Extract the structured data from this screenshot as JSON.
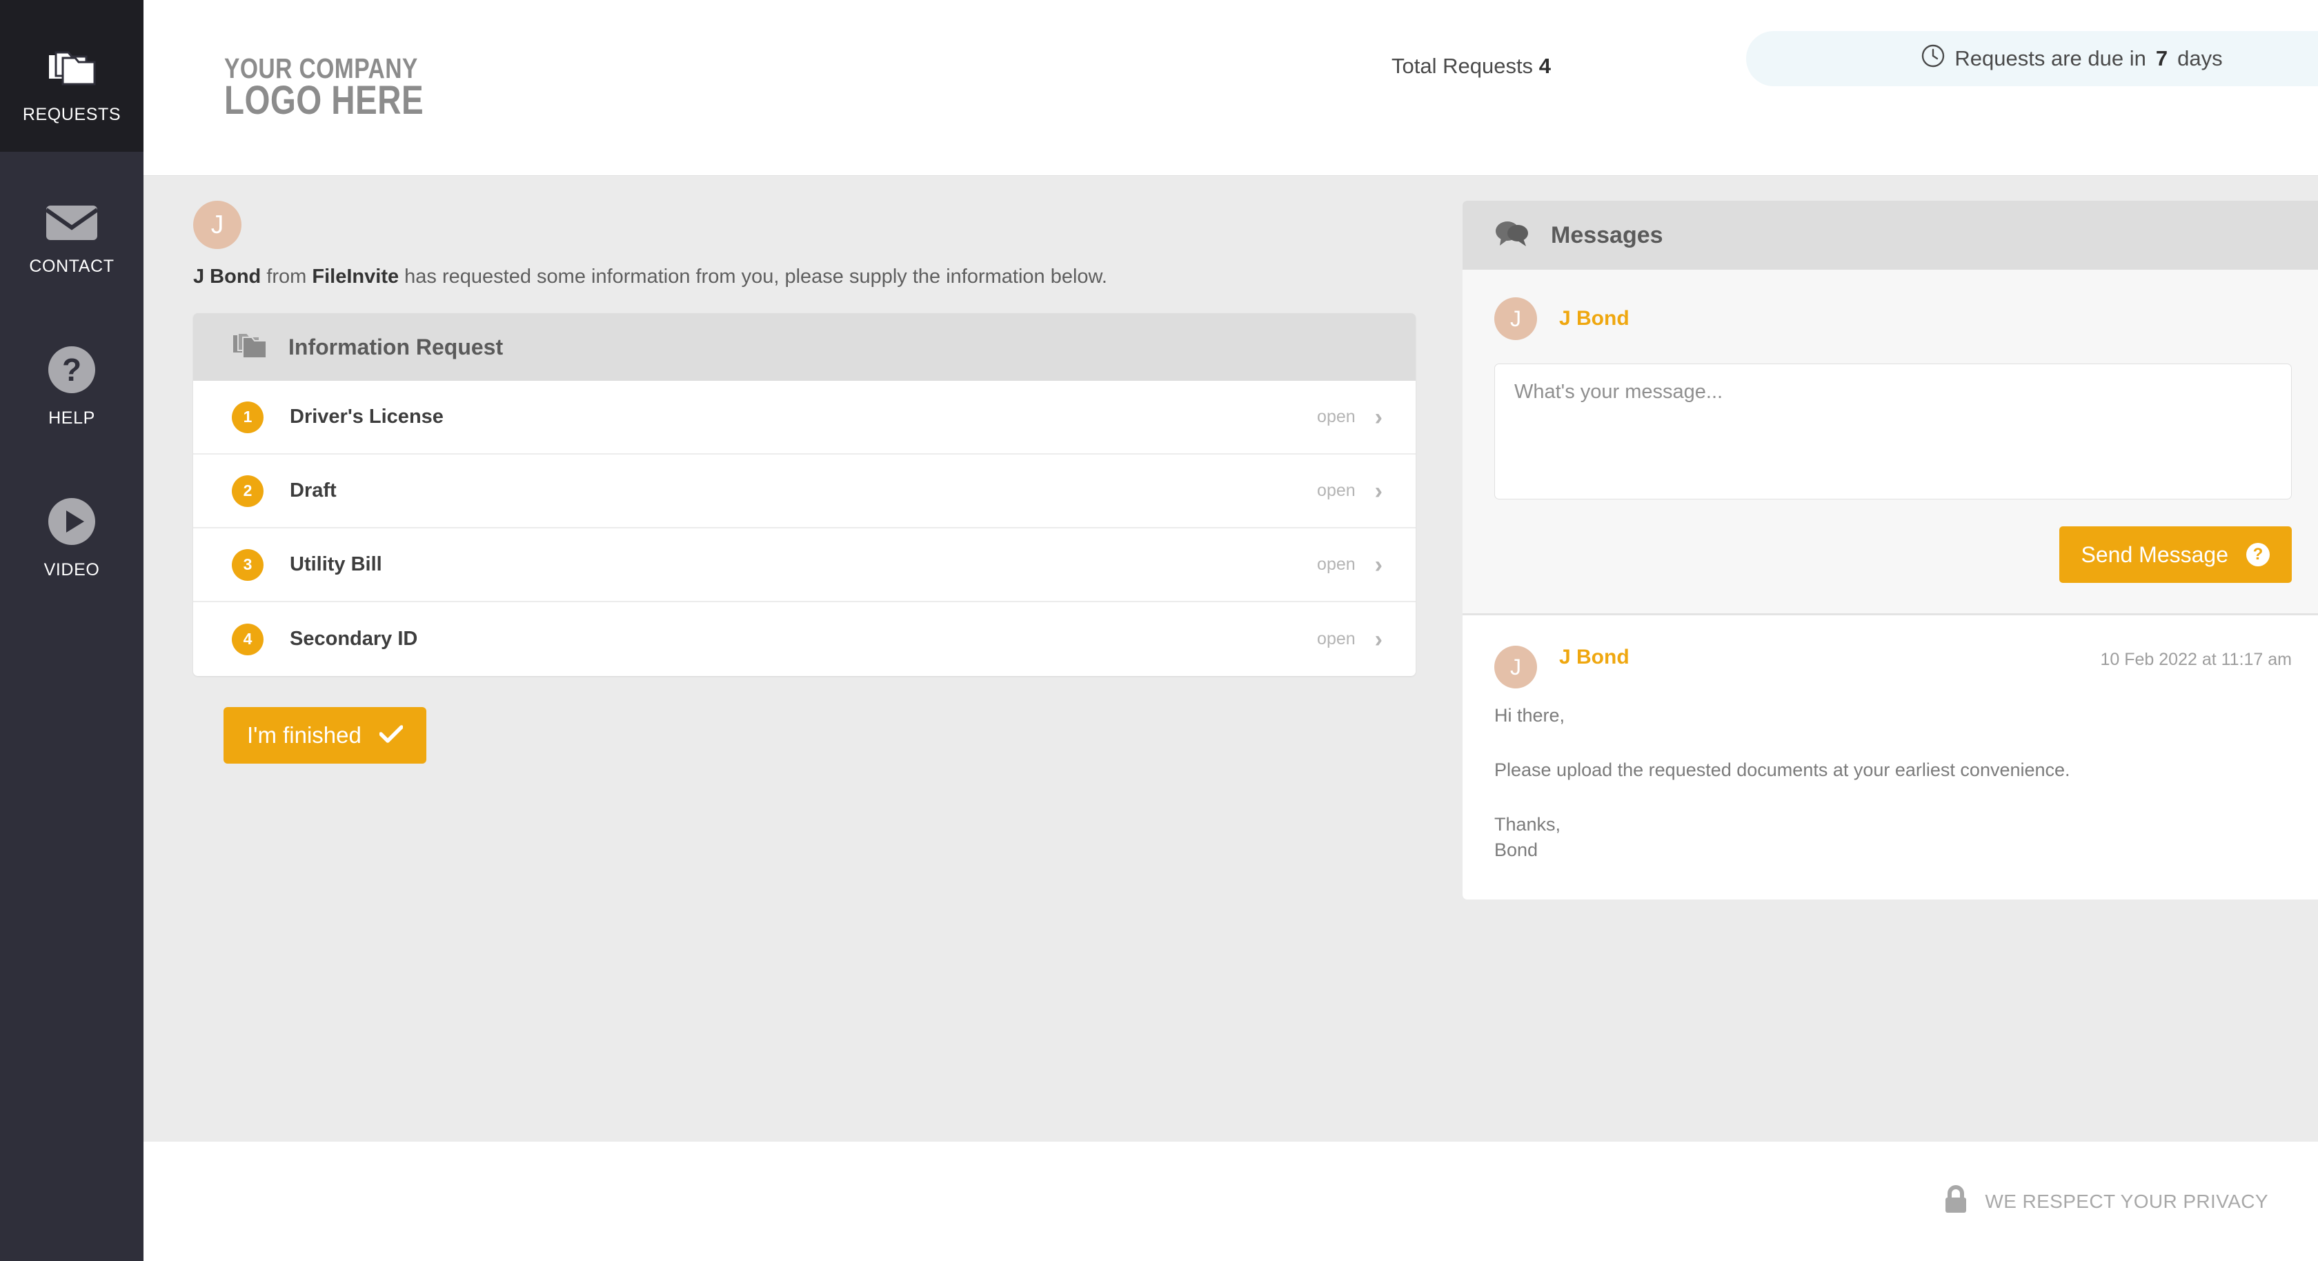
{
  "sidebar": {
    "items": [
      {
        "label": "REQUESTS",
        "icon": "folders-icon",
        "active": true
      },
      {
        "label": "CONTACT",
        "icon": "envelope-icon",
        "active": false
      },
      {
        "label": "HELP",
        "icon": "question-circle-icon",
        "active": false
      },
      {
        "label": "VIDEO",
        "icon": "play-circle-icon",
        "active": false
      }
    ]
  },
  "header": {
    "logo_line1": "YOUR COMPANY",
    "logo_line2": "LOGO HERE",
    "total_requests_label": "Total Requests",
    "total_requests_count": "4",
    "due_prefix": "Requests are due in",
    "due_days": "7",
    "due_suffix": "days",
    "due_pill_bg": "#eff7fa",
    "clock_icon": "clock-icon"
  },
  "intro": {
    "avatar_initial": "J",
    "sender": "J Bond",
    "from_word": "from",
    "company": "FileInvite",
    "rest": "has requested some information from you, please supply the information below."
  },
  "request_card": {
    "title": "Information Request",
    "icon": "folders-icon",
    "rows": [
      {
        "num": "1",
        "title": "Driver's License",
        "status": "open"
      },
      {
        "num": "2",
        "title": "Draft",
        "status": "open"
      },
      {
        "num": "3",
        "title": "Utility Bill",
        "status": "open"
      },
      {
        "num": "4",
        "title": "Secondary ID",
        "status": "open"
      }
    ],
    "finished_label": "I'm finished",
    "finished_icon": "check-icon"
  },
  "messages": {
    "panel_title": "Messages",
    "panel_icon": "chat-bubbles-icon",
    "compose": {
      "avatar_initial": "J",
      "author": "J Bond",
      "placeholder": "What's your message...",
      "value": "",
      "send_label": "Send Message",
      "send_icon": "question-circle-icon"
    },
    "thread": [
      {
        "avatar_initial": "J",
        "author": "J Bond",
        "timestamp": "10 Feb 2022 at 11:17 am",
        "line1": "Hi there,",
        "line2": "Please upload the requested documents at your earliest convenience.",
        "line3": "Thanks,",
        "line4": "Bond"
      }
    ]
  },
  "footer": {
    "privacy_text": "WE RESPECT YOUR PRIVACY",
    "lock_icon": "lock-icon"
  },
  "colors": {
    "accent_orange": "#efa70f",
    "sidebar_bg": "#2f2f3a",
    "sidebar_active_bg": "#1e1e23",
    "content_bg": "#ebebeb",
    "avatar_bg": "#e4c0a9"
  }
}
